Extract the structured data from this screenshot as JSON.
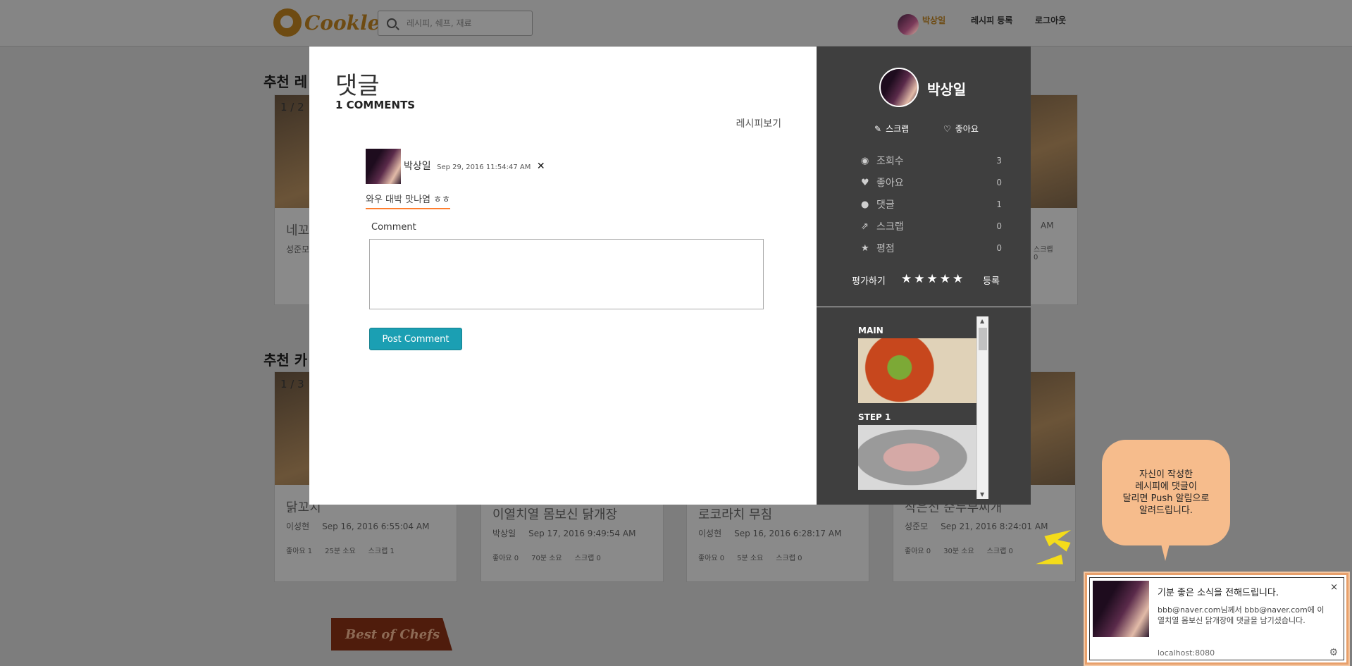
{
  "header": {
    "logo_text": "Cookle",
    "search_placeholder": "레시피, 쉐프, 재료",
    "nav": {
      "user": "박상일",
      "register": "레시피 등록",
      "logout": "로그아웃"
    }
  },
  "background": {
    "headings": [
      "추천 레",
      "추천 카"
    ],
    "row1": [
      {
        "counter": "1 / 2",
        "title": "네꼬",
        "author": "성준모",
        "date": "",
        "likes": "",
        "time": "",
        "scraps": ""
      },
      {
        "counter": "",
        "title": "",
        "author": "",
        "date": "",
        "likes": "",
        "time": "",
        "scraps": ""
      },
      {
        "counter": "",
        "title": "",
        "author": "",
        "date": "",
        "likes": "",
        "time": "",
        "scraps": ""
      },
      {
        "counter": "",
        "title": "",
        "author": "",
        "date": "AM",
        "likes": "",
        "time": "",
        "scraps": "스크랩 0"
      }
    ],
    "row2": [
      {
        "counter": "1 / 3",
        "title": "닭꼬치",
        "author": "이성현",
        "date": "Sep 16, 2016 6:55:04 AM",
        "likes": "좋아요 1",
        "time": "25분 소요",
        "scraps": "스크랩 1"
      },
      {
        "counter": "",
        "title": "이열치열 몸보신 닭개장",
        "author": "박상일",
        "date": "Sep 17, 2016 9:49:54 AM",
        "likes": "좋아요 0",
        "time": "70분 소요",
        "scraps": "스크랩 0"
      },
      {
        "counter": "",
        "title": "로코라치 무침",
        "author": "이성현",
        "date": "Sep 16, 2016 6:28:17 AM",
        "likes": "좋아요 0",
        "time": "5분 소요",
        "scraps": "스크랩 0"
      },
      {
        "counter": "",
        "title": "작은전 순두부찌개",
        "author": "성준모",
        "date": "Sep 21, 2016 8:24:01 AM",
        "likes": "좋아요 0",
        "time": "30분 소요",
        "scraps": "스크랩 0"
      }
    ],
    "chefs_banner": "Best of Chefs"
  },
  "modal": {
    "title": "댓글",
    "comment_count": "1 COMMENTS",
    "recipe_link": "레시피보기",
    "comments": [
      {
        "author": "박상일",
        "date": "Sep 29, 2016 11:54:47 AM",
        "delete": "✕",
        "text": "와우 대박 맛나염 ㅎㅎ"
      }
    ],
    "form": {
      "label": "Comment",
      "value": "",
      "submit": "Post Comment"
    },
    "profile": {
      "name": "박상일",
      "scrap": "스크랩",
      "like": "좋아요",
      "stats": [
        {
          "icon": "eye-icon",
          "glyph": "◉",
          "label": "조회수",
          "value": "3"
        },
        {
          "icon": "heart-icon",
          "glyph": "♥",
          "label": "좋아요",
          "value": "0"
        },
        {
          "icon": "comments-icon",
          "glyph": "●",
          "label": "댓글",
          "value": "1"
        },
        {
          "icon": "external-link-icon",
          "glyph": "⇗",
          "label": "스크랩",
          "value": "0"
        },
        {
          "icon": "star-icon",
          "glyph": "★",
          "label": "평점",
          "value": "0"
        }
      ],
      "rate_label": "평가하기",
      "rate_submit": "등록",
      "stars": 5
    },
    "steps": [
      {
        "label": "MAIN"
      },
      {
        "label": "STEP 1"
      }
    ]
  },
  "push_bubble": "자신이 작성한\n레시피에 댓글이\n달리면 Push 알림으로\n알려드립니다.",
  "notification": {
    "title": "기분 좋은 소식을 전해드립니다.",
    "body": "bbb@naver.com님께서 bbb@naver.com에 이열치열 몸보신 닭개장에 댓글을 남기셨습니다.",
    "host": "localhost:8080",
    "close": "×"
  }
}
